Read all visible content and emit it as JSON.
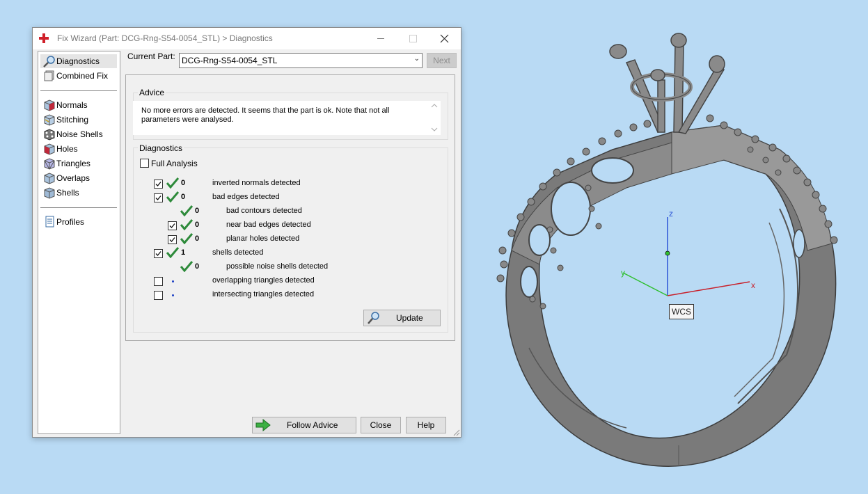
{
  "window": {
    "title": "Fix Wizard (Part: DCG-Rng-S54-0054_STL) > Diagnostics"
  },
  "nav": {
    "top_items": [
      {
        "label": "Diagnostics",
        "icon": "magnifier-icon",
        "selected": true
      },
      {
        "label": "Combined Fix",
        "icon": "combined-fix-icon"
      }
    ],
    "tool_items": [
      {
        "label": "Normals",
        "icon": "normals-cube-icon"
      },
      {
        "label": "Stitching",
        "icon": "stitching-cube-icon"
      },
      {
        "label": "Noise Shells",
        "icon": "noise-shells-cube-icon"
      },
      {
        "label": "Holes",
        "icon": "holes-cube-icon"
      },
      {
        "label": "Triangles",
        "icon": "triangles-cube-icon"
      },
      {
        "label": "Overlaps",
        "icon": "overlaps-cube-icon"
      },
      {
        "label": "Shells",
        "icon": "shells-cube-icon"
      }
    ],
    "bottom_items": [
      {
        "label": "Profiles",
        "icon": "profiles-document-icon"
      }
    ]
  },
  "current_part": {
    "label": "Current Part:",
    "value": "DCG-Rng-S54-0054_STL",
    "next_label": "Next"
  },
  "advice": {
    "title": "Advice",
    "text_line1": "No more errors are detected. It seems that the part is ok. Note that not all",
    "text_line2": "parameters were analysed."
  },
  "diagnostics": {
    "title": "Diagnostics",
    "full_analysis_label": "Full Analysis",
    "full_analysis_checked": false,
    "rows": [
      {
        "checkbox": true,
        "checked": true,
        "status": "ok",
        "count": "0",
        "label": "inverted normals detected",
        "indent": 0
      },
      {
        "checkbox": true,
        "checked": true,
        "status": "ok",
        "count": "0",
        "label": "bad edges detected",
        "indent": 0
      },
      {
        "checkbox": false,
        "checked": false,
        "status": "ok",
        "count": "0",
        "label": "bad contours detected",
        "indent": 1
      },
      {
        "checkbox": true,
        "checked": true,
        "status": "ok",
        "count": "0",
        "label": "near bad edges detected",
        "indent": 1
      },
      {
        "checkbox": true,
        "checked": true,
        "status": "ok",
        "count": "0",
        "label": "planar holes detected",
        "indent": 1
      },
      {
        "checkbox": true,
        "checked": true,
        "status": "ok",
        "count": "1",
        "label": "shells detected",
        "indent": 0
      },
      {
        "checkbox": false,
        "checked": false,
        "status": "ok",
        "count": "0",
        "label": "possible noise shells detected",
        "indent": 1
      },
      {
        "checkbox": true,
        "checked": false,
        "status": "pending",
        "count": "",
        "label": "overlapping triangles detected",
        "indent": 0
      },
      {
        "checkbox": true,
        "checked": false,
        "status": "pending",
        "count": "",
        "label": "intersecting triangles detected",
        "indent": 0
      }
    ],
    "update_label": "Update"
  },
  "footer": {
    "follow_advice_label": "Follow Advice",
    "close_label": "Close",
    "help_label": "Help"
  },
  "viewport": {
    "wcs_label": "WCS",
    "axis_x": "x",
    "axis_y": "y",
    "axis_z": "z"
  },
  "colors": {
    "background": "#b9daf4",
    "check_green": "#2d8a3a",
    "axis_x": "#c8202a",
    "axis_y": "#2fbf2f",
    "axis_z": "#2a52d6",
    "ring_gray": "#7d7d7d"
  }
}
